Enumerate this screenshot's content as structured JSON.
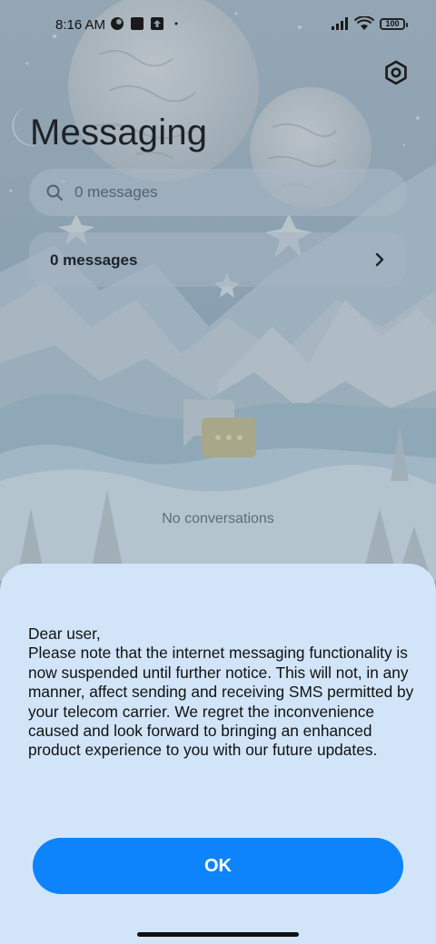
{
  "status_bar": {
    "time": "8:16 AM",
    "battery": "100",
    "icons": [
      "notification-app-icon",
      "notification-square-icon",
      "upload-icon",
      "dot-icon",
      "cellular-signal-icon",
      "wifi-icon",
      "battery-icon"
    ]
  },
  "header": {
    "title": "Messaging",
    "settings_icon": "settings-hexagon-icon"
  },
  "search": {
    "placeholder": "0 messages",
    "icon": "search-icon"
  },
  "messages_row": {
    "label": "0 messages",
    "icon": "chevron-right-icon"
  },
  "empty_state": {
    "icon": "chat-bubbles-icon",
    "text": "No conversations"
  },
  "dialog": {
    "greeting": "Dear user,",
    "message": "Please note that the internet messaging functionality is now suspended until further notice. This will not, in any manner, affect sending and receiving SMS permitted by your telecom carrier. We regret the inconvenience caused and look forward to bringing an enhanced product experience to you with our future updates.",
    "ok_label": "OK"
  },
  "colors": {
    "accent": "#0d84fb",
    "sheet_background": "#d2e5f8"
  }
}
